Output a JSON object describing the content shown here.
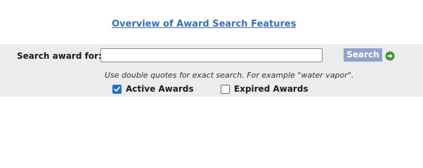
{
  "overview_link": {
    "text": "Overview of Award Search Features"
  },
  "search": {
    "label": "Search award for:",
    "value": "",
    "placeholder": "",
    "button_label": "Search",
    "hint": "Use double quotes for exact search. For example \"water vapor\"."
  },
  "filters": {
    "active": {
      "label": "Active Awards",
      "checked": true
    },
    "expired": {
      "label": "Expired Awards",
      "checked": false
    }
  },
  "icons": {
    "go": "arrow-right-circle-icon",
    "check": "checkmark-icon"
  },
  "colors": {
    "link": "#3a6cb8",
    "panel_bg": "#ececec",
    "button_bg": "#8fa3cf",
    "go_icon": "#3b9a2f",
    "checkbox_checked": "#1f6fd6"
  }
}
